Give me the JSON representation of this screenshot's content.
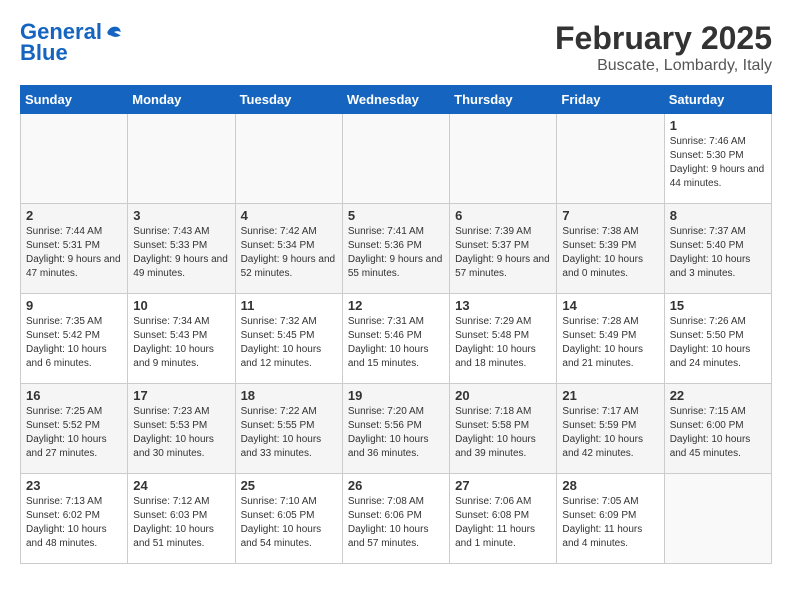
{
  "header": {
    "logo_line1": "General",
    "logo_line2": "Blue",
    "month": "February 2025",
    "location": "Buscate, Lombardy, Italy"
  },
  "weekdays": [
    "Sunday",
    "Monday",
    "Tuesday",
    "Wednesday",
    "Thursday",
    "Friday",
    "Saturday"
  ],
  "weeks": [
    [
      {
        "day": "",
        "info": ""
      },
      {
        "day": "",
        "info": ""
      },
      {
        "day": "",
        "info": ""
      },
      {
        "day": "",
        "info": ""
      },
      {
        "day": "",
        "info": ""
      },
      {
        "day": "",
        "info": ""
      },
      {
        "day": "1",
        "info": "Sunrise: 7:46 AM\nSunset: 5:30 PM\nDaylight: 9 hours and 44 minutes."
      }
    ],
    [
      {
        "day": "2",
        "info": "Sunrise: 7:44 AM\nSunset: 5:31 PM\nDaylight: 9 hours and 47 minutes."
      },
      {
        "day": "3",
        "info": "Sunrise: 7:43 AM\nSunset: 5:33 PM\nDaylight: 9 hours and 49 minutes."
      },
      {
        "day": "4",
        "info": "Sunrise: 7:42 AM\nSunset: 5:34 PM\nDaylight: 9 hours and 52 minutes."
      },
      {
        "day": "5",
        "info": "Sunrise: 7:41 AM\nSunset: 5:36 PM\nDaylight: 9 hours and 55 minutes."
      },
      {
        "day": "6",
        "info": "Sunrise: 7:39 AM\nSunset: 5:37 PM\nDaylight: 9 hours and 57 minutes."
      },
      {
        "day": "7",
        "info": "Sunrise: 7:38 AM\nSunset: 5:39 PM\nDaylight: 10 hours and 0 minutes."
      },
      {
        "day": "8",
        "info": "Sunrise: 7:37 AM\nSunset: 5:40 PM\nDaylight: 10 hours and 3 minutes."
      }
    ],
    [
      {
        "day": "9",
        "info": "Sunrise: 7:35 AM\nSunset: 5:42 PM\nDaylight: 10 hours and 6 minutes."
      },
      {
        "day": "10",
        "info": "Sunrise: 7:34 AM\nSunset: 5:43 PM\nDaylight: 10 hours and 9 minutes."
      },
      {
        "day": "11",
        "info": "Sunrise: 7:32 AM\nSunset: 5:45 PM\nDaylight: 10 hours and 12 minutes."
      },
      {
        "day": "12",
        "info": "Sunrise: 7:31 AM\nSunset: 5:46 PM\nDaylight: 10 hours and 15 minutes."
      },
      {
        "day": "13",
        "info": "Sunrise: 7:29 AM\nSunset: 5:48 PM\nDaylight: 10 hours and 18 minutes."
      },
      {
        "day": "14",
        "info": "Sunrise: 7:28 AM\nSunset: 5:49 PM\nDaylight: 10 hours and 21 minutes."
      },
      {
        "day": "15",
        "info": "Sunrise: 7:26 AM\nSunset: 5:50 PM\nDaylight: 10 hours and 24 minutes."
      }
    ],
    [
      {
        "day": "16",
        "info": "Sunrise: 7:25 AM\nSunset: 5:52 PM\nDaylight: 10 hours and 27 minutes."
      },
      {
        "day": "17",
        "info": "Sunrise: 7:23 AM\nSunset: 5:53 PM\nDaylight: 10 hours and 30 minutes."
      },
      {
        "day": "18",
        "info": "Sunrise: 7:22 AM\nSunset: 5:55 PM\nDaylight: 10 hours and 33 minutes."
      },
      {
        "day": "19",
        "info": "Sunrise: 7:20 AM\nSunset: 5:56 PM\nDaylight: 10 hours and 36 minutes."
      },
      {
        "day": "20",
        "info": "Sunrise: 7:18 AM\nSunset: 5:58 PM\nDaylight: 10 hours and 39 minutes."
      },
      {
        "day": "21",
        "info": "Sunrise: 7:17 AM\nSunset: 5:59 PM\nDaylight: 10 hours and 42 minutes."
      },
      {
        "day": "22",
        "info": "Sunrise: 7:15 AM\nSunset: 6:00 PM\nDaylight: 10 hours and 45 minutes."
      }
    ],
    [
      {
        "day": "23",
        "info": "Sunrise: 7:13 AM\nSunset: 6:02 PM\nDaylight: 10 hours and 48 minutes."
      },
      {
        "day": "24",
        "info": "Sunrise: 7:12 AM\nSunset: 6:03 PM\nDaylight: 10 hours and 51 minutes."
      },
      {
        "day": "25",
        "info": "Sunrise: 7:10 AM\nSunset: 6:05 PM\nDaylight: 10 hours and 54 minutes."
      },
      {
        "day": "26",
        "info": "Sunrise: 7:08 AM\nSunset: 6:06 PM\nDaylight: 10 hours and 57 minutes."
      },
      {
        "day": "27",
        "info": "Sunrise: 7:06 AM\nSunset: 6:08 PM\nDaylight: 11 hours and 1 minute."
      },
      {
        "day": "28",
        "info": "Sunrise: 7:05 AM\nSunset: 6:09 PM\nDaylight: 11 hours and 4 minutes."
      },
      {
        "day": "",
        "info": ""
      }
    ]
  ]
}
